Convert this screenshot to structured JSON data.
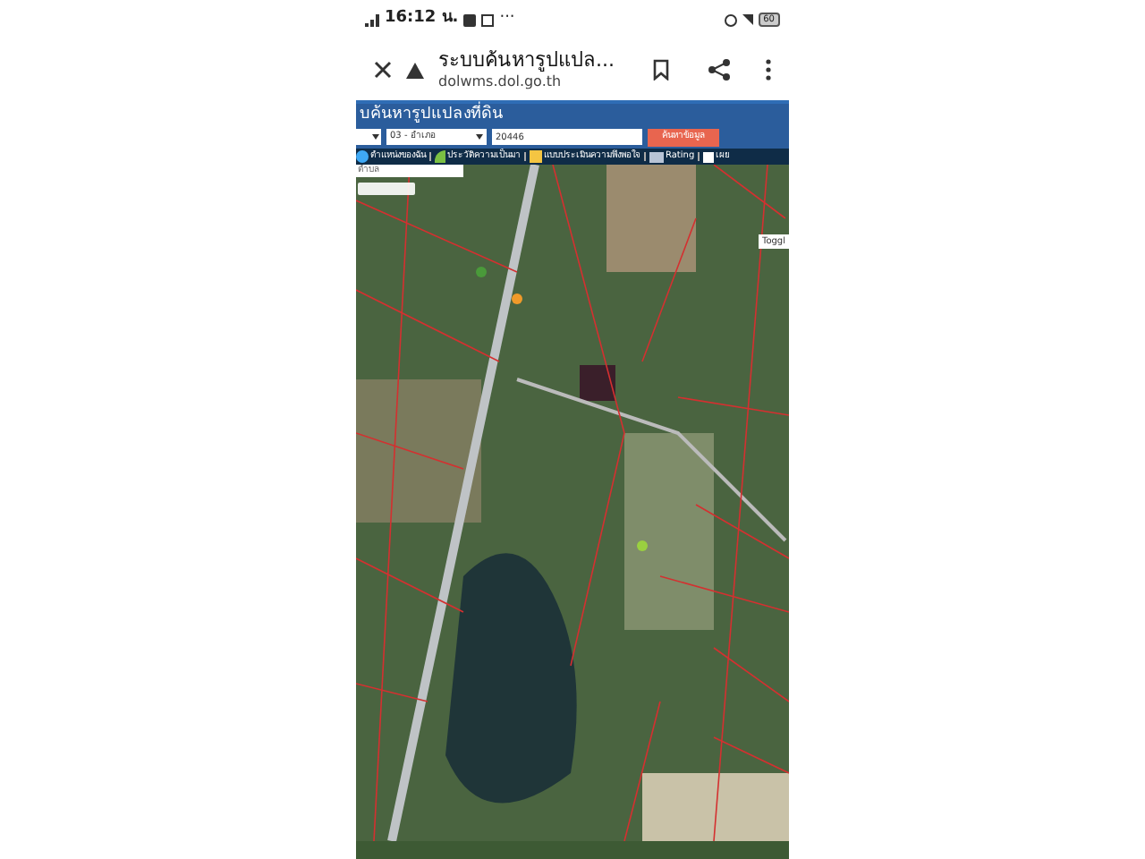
{
  "status_bar": {
    "time": "16:12 น.",
    "dots": "···",
    "battery": "60"
  },
  "browser": {
    "title": "ระบบค้นหารูปแปล...",
    "url": "dolwms.dol.go.th"
  },
  "page": {
    "title": "บค้นหารูปแปลงที่ดิน",
    "search": {
      "district": "03 - อำเภอ",
      "parcel": "20446",
      "button": "ค้นหาข้อมูล"
    },
    "toolbar": [
      {
        "label": "ตำแหน่งของฉัน",
        "kind": "globe"
      },
      {
        "label": "ประวัติความเป็นมา",
        "kind": "sprout"
      },
      {
        "label": "แบบประเมินความพึงพอใจ",
        "kind": "form"
      },
      {
        "label": "Rating",
        "kind": "chart"
      },
      {
        "label": "เผย",
        "kind": "box"
      }
    ],
    "subdistrict_field": {
      "placeholder": "ตำบล"
    },
    "map": {
      "toggle": "Toggl"
    }
  }
}
